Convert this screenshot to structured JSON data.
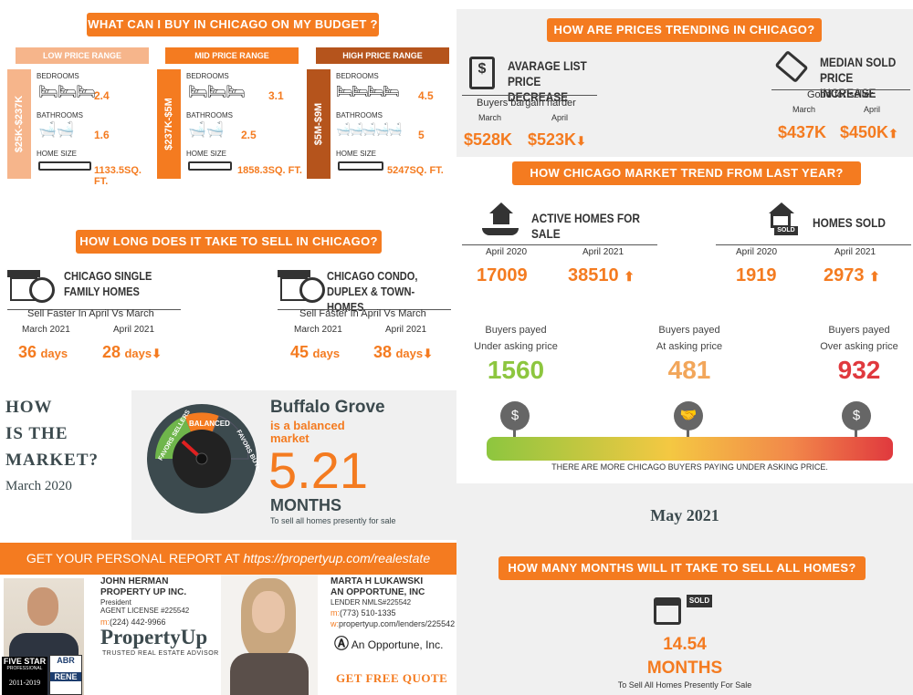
{
  "budget": {
    "title": "WHAT CAN I BUY IN CHICAGO ON MY BUDGET ?",
    "labels": {
      "bed": "BEDROOMS",
      "bath": "BATHROOMS",
      "size": "HOME SIZE"
    },
    "ranges": [
      {
        "name": "LOW PRICE RANGE",
        "side": "$25K-$237K",
        "bedrooms": "2.4",
        "bathrooms": "1.6",
        "size": "1133.5SQ. FT.",
        "color": "#f6b58b",
        "head": "#f6b58b"
      },
      {
        "name": "MID PRICE RANGE",
        "side": "$237K-$5M",
        "bedrooms": "3.1",
        "bathrooms": "2.5",
        "size": "1858.3SQ. FT.",
        "color": "#f47b20",
        "head": "#f47b20"
      },
      {
        "name": "HIGH PRICE RANGE",
        "side": "$5M-$9M",
        "bedrooms": "4.5",
        "bathrooms": "5",
        "size": "5247SQ. FT.",
        "color": "#b5541c",
        "head": "#b5541c"
      }
    ]
  },
  "sell": {
    "title": "HOW LONG DOES IT TAKE TO SELL IN CHICAGO?",
    "items": [
      {
        "title": "CHICAGO SINGLE FAMILY HOMES",
        "sub": "Sell Faster In April Vs March",
        "m1": "March 2021",
        "m2": "April 2021",
        "v1": "36",
        "v2": "28",
        "unit": "days"
      },
      {
        "title": "CHICAGO CONDO, DUPLEX & TOWN-HOMES",
        "sub": "Sell Faster In April Vs March",
        "m1": "March 2021",
        "m2": "April 2021",
        "v1": "45",
        "v2": "38",
        "unit": "days"
      }
    ]
  },
  "market": {
    "how1": "HOW",
    "how2": "IS THE",
    "how3": "MARKET?",
    "date": "March 2020",
    "place": "Buffalo Grove",
    "status": "is a balanced market",
    "value": "5.21",
    "unit": "MONTHS",
    "note": "To sell all homes presently for sale",
    "gauge": {
      "left": "FAVORS SELLERS",
      "mid": "BALANCED",
      "right": "FAVORS BUYERS"
    }
  },
  "report": {
    "label": "GET YOUR PERSONAL REPORT AT",
    "url": "https://propertyup.com/realestate"
  },
  "agent1": {
    "name": "JOHN HERMAN",
    "company": "PROPERTY UP INC.",
    "role": "President",
    "license": "AGENT LICENSE #225542",
    "phone_prefix": "m:",
    "phone": "(224) 442-9966",
    "logo": "PropertyUp",
    "tagline": "TRUSTED REAL ESTATE ADVISOR",
    "badge1": "FIVE STAR",
    "badge1b": "PROFESSIONAL",
    "badge2": "2011-2019",
    "badge3": "ABR",
    "badge4": "RENE"
  },
  "agent2": {
    "name": "MARTA H LUKAWSKI",
    "company": "AN OPPORTUNE, INC",
    "license": "LENDER NMLS#225542",
    "phone_prefix": "m:",
    "phone": "(773) 510-1335",
    "web_prefix": "w:",
    "web": "propertyup.com/lenders/225542",
    "logo": "An Opportune, Inc.",
    "quote": "GET FREE QUOTE"
  },
  "trend": {
    "title": "HOW ARE PRICES TRENDING IN CHICAGO?",
    "list": {
      "title": "AVARAGE LIST PRICE DECREASE",
      "sub": "Buyers bargain harder",
      "m1": "March",
      "m2": "April",
      "v1": "$528K",
      "v2": "$523K"
    },
    "sold": {
      "title": "MEDIAN SOLD PRICE INCREASE",
      "sub": "Good for seller",
      "m1": "March",
      "m2": "April",
      "v1": "$437K",
      "v2": "$450K"
    }
  },
  "yoy": {
    "title": "HOW CHICAGO MARKET TREND FROM LAST YEAR?",
    "active": {
      "title": "ACTIVE HOMES FOR SALE",
      "m1": "April 2020",
      "m2": "April 2021",
      "v1": "17009",
      "v2": "38510"
    },
    "sold": {
      "title": "HOMES SOLD",
      "m1": "April 2020",
      "m2": "April 2021",
      "v1": "1919",
      "v2": "2973",
      "tag": "SOLD"
    }
  },
  "buyers": {
    "items": [
      {
        "l1": "Buyers payed",
        "l2": "Under asking price",
        "v": "1560",
        "color": "#8dc63f"
      },
      {
        "l1": "Buyers payed",
        "l2": "At asking price",
        "v": "481",
        "color": "#f2a65a"
      },
      {
        "l1": "Buyers payed",
        "l2": "Over asking price",
        "v": "932",
        "color": "#e0393e"
      }
    ],
    "note": "THERE ARE MORE CHICAGO BUYERS PAYING UNDER ASKING PRICE."
  },
  "months": {
    "date": "May 2021",
    "title": "HOW MANY MONTHS WILL IT TAKE TO SELL ALL HOMES?",
    "value": "14.54",
    "unit": "MONTHS",
    "note": "To Sell All Homes Presently For Sale",
    "tag": "SOLD"
  }
}
